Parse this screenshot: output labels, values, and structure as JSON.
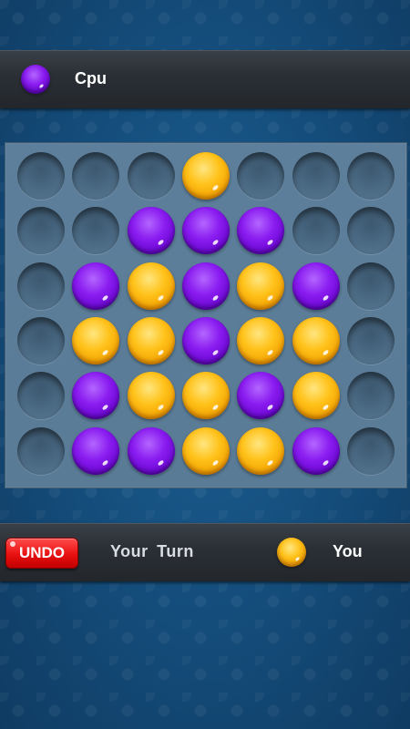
{
  "top_player": {
    "name": "Cpu",
    "chip_color": "purple"
  },
  "bottom_player": {
    "name": "You",
    "chip_color": "orange"
  },
  "status": {
    "turn_text": "Your  Turn"
  },
  "undo": {
    "label": "UNDO"
  },
  "colors": {
    "purple": "#7a12e6",
    "orange": "#f7b10f",
    "undo_red": "#e81010"
  },
  "board": {
    "columns": 7,
    "rows": 6,
    "cells": [
      [
        "empty",
        "empty",
        "empty",
        "orange",
        "empty",
        "empty",
        "empty"
      ],
      [
        "empty",
        "empty",
        "purple",
        "purple",
        "purple",
        "empty",
        "empty"
      ],
      [
        "empty",
        "purple",
        "orange",
        "purple",
        "orange",
        "purple",
        "empty"
      ],
      [
        "empty",
        "orange",
        "orange",
        "purple",
        "orange",
        "orange",
        "empty"
      ],
      [
        "empty",
        "purple",
        "orange",
        "orange",
        "purple",
        "orange",
        "empty"
      ],
      [
        "empty",
        "purple",
        "purple",
        "orange",
        "orange",
        "purple",
        "empty"
      ]
    ]
  }
}
